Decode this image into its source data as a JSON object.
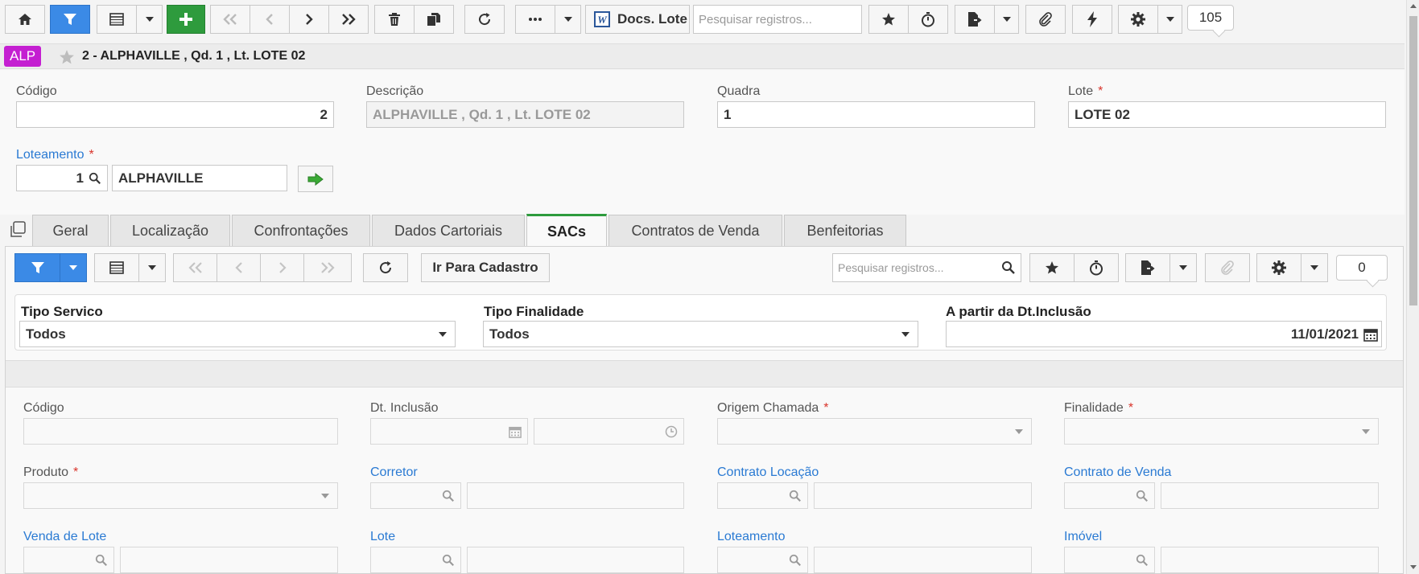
{
  "toolbar": {
    "docs_label": "Docs. Lote",
    "search_placeholder": "Pesquisar registros...",
    "record_count": "105"
  },
  "record": {
    "badge": "ALP",
    "title": "2 - ALPHAVILLE , Qd. 1 , Lt. LOTE 02"
  },
  "form": {
    "codigo_label": "Código",
    "codigo_value": "2",
    "descricao_label": "Descrição",
    "descricao_value": "ALPHAVILLE ,  Qd. 1 ,  Lt. LOTE 02",
    "quadra_label": "Quadra",
    "quadra_value": "1",
    "lote_label": "Lote",
    "lote_value": "LOTE 02",
    "loteamento_label": "Loteamento",
    "loteamento_code": "1",
    "loteamento_name": "ALPHAVILLE",
    "required_mark": "*"
  },
  "tabs": [
    {
      "label": "Geral"
    },
    {
      "label": "Localização"
    },
    {
      "label": "Confrontações"
    },
    {
      "label": "Dados Cartoriais"
    },
    {
      "label": "SACs"
    },
    {
      "label": "Contratos de Venda"
    },
    {
      "label": "Benfeitorias"
    }
  ],
  "sac": {
    "ir_para_cadastro": "Ir Para Cadastro",
    "search_placeholder": "Pesquisar registros...",
    "record_count": "0",
    "filter": {
      "tipo_servico_label": "Tipo Servico",
      "tipo_servico_value": "Todos",
      "tipo_finalidade_label": "Tipo Finalidade",
      "tipo_finalidade_value": "Todos",
      "dt_inclusao_label": "A partir da Dt.Inclusão",
      "dt_inclusao_value": "11/01/2021"
    },
    "detail": {
      "codigo": "Código",
      "dt_inclusao": "Dt. Inclusão",
      "origem_chamada": "Origem Chamada",
      "finalidade": "Finalidade",
      "produto": "Produto",
      "corretor": "Corretor",
      "contrato_locacao": "Contrato Locação",
      "contrato_venda": "Contrato de Venda",
      "venda_lote": "Venda de Lote",
      "lote": "Lote",
      "loteamento": "Loteamento",
      "imovel": "Imóvel"
    }
  },
  "colors": {
    "accent_blue": "#3b8ae6",
    "accent_green": "#2e9b3d",
    "badge_purple": "#c41fd1",
    "link_blue": "#2a7ad3",
    "required_red": "#d9342b"
  }
}
